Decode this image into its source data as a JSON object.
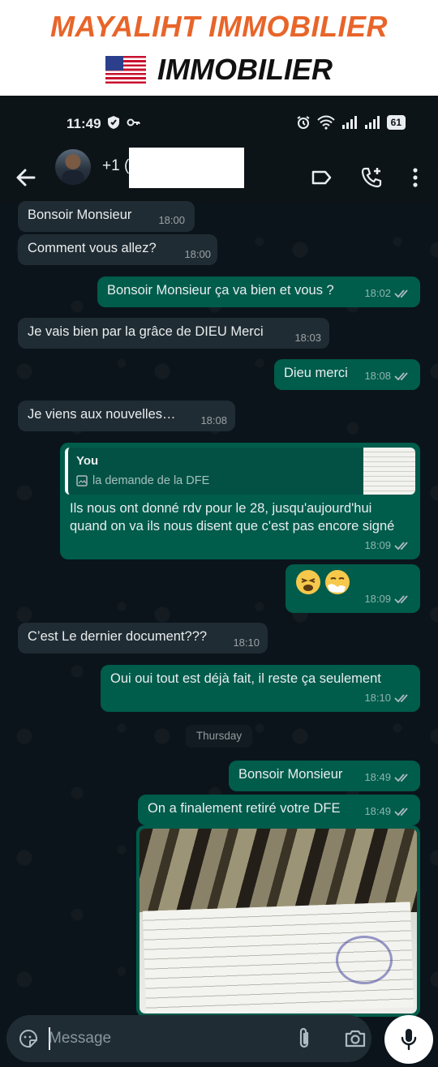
{
  "brand": {
    "title": "MAYALIHT IMMOBILIER",
    "subtitle": "IMMOBILIER",
    "flag_icon": "us-flag-icon"
  },
  "status_bar": {
    "time": "11:49",
    "battery": "61"
  },
  "header": {
    "contact_prefix": "+1 ("
  },
  "messages": [
    {
      "id": "m1",
      "dir": "in",
      "text": "Bonsoir Monsieur",
      "time": "18:00"
    },
    {
      "id": "m2",
      "dir": "in",
      "text": "Comment vous allez?",
      "time": "18:00"
    },
    {
      "id": "m3",
      "dir": "out",
      "text": "Bonsoir Monsieur ça va bien et vous ?",
      "time": "18:02"
    },
    {
      "id": "m4",
      "dir": "in",
      "text": "Je vais bien par la grâce de DIEU Merci",
      "time": "18:03"
    },
    {
      "id": "m5",
      "dir": "out",
      "text": "Dieu merci",
      "time": "18:08"
    },
    {
      "id": "m6",
      "dir": "in",
      "text": "Je viens aux nouvelles…",
      "time": "18:08"
    },
    {
      "id": "m7",
      "dir": "out",
      "quote_author": "You",
      "quote_caption": "la demande de la DFE",
      "text": "Ils nous ont donné rdv pour le 28, jusqu'aujourd'hui quand on va ils nous disent que c'est pas encore signé",
      "time": "18:09"
    },
    {
      "id": "m8",
      "dir": "out",
      "emojis": [
        "tired-face-emoji",
        "sneezing-face-emoji"
      ],
      "time": "18:09"
    },
    {
      "id": "m9",
      "dir": "in",
      "text": "C’est Le dernier document???",
      "time": "18:10"
    },
    {
      "id": "m10",
      "dir": "out",
      "text": "Oui oui tout est déjà fait, il reste ça seulement",
      "time": "18:10"
    },
    {
      "id": "m11",
      "dir": "out",
      "text": "Bonsoir Monsieur",
      "time": "18:49"
    },
    {
      "id": "m12",
      "dir": "out",
      "text": "On a finalement retiré votre DFE",
      "time": "18:49"
    }
  ],
  "day_divider": "Thursday",
  "composer": {
    "placeholder": "Message"
  },
  "colors": {
    "brand_orange": "#e8652a",
    "incoming_bubble": "#202c33",
    "outgoing_bubble": "#005c4b",
    "chat_background": "#0b141a"
  }
}
